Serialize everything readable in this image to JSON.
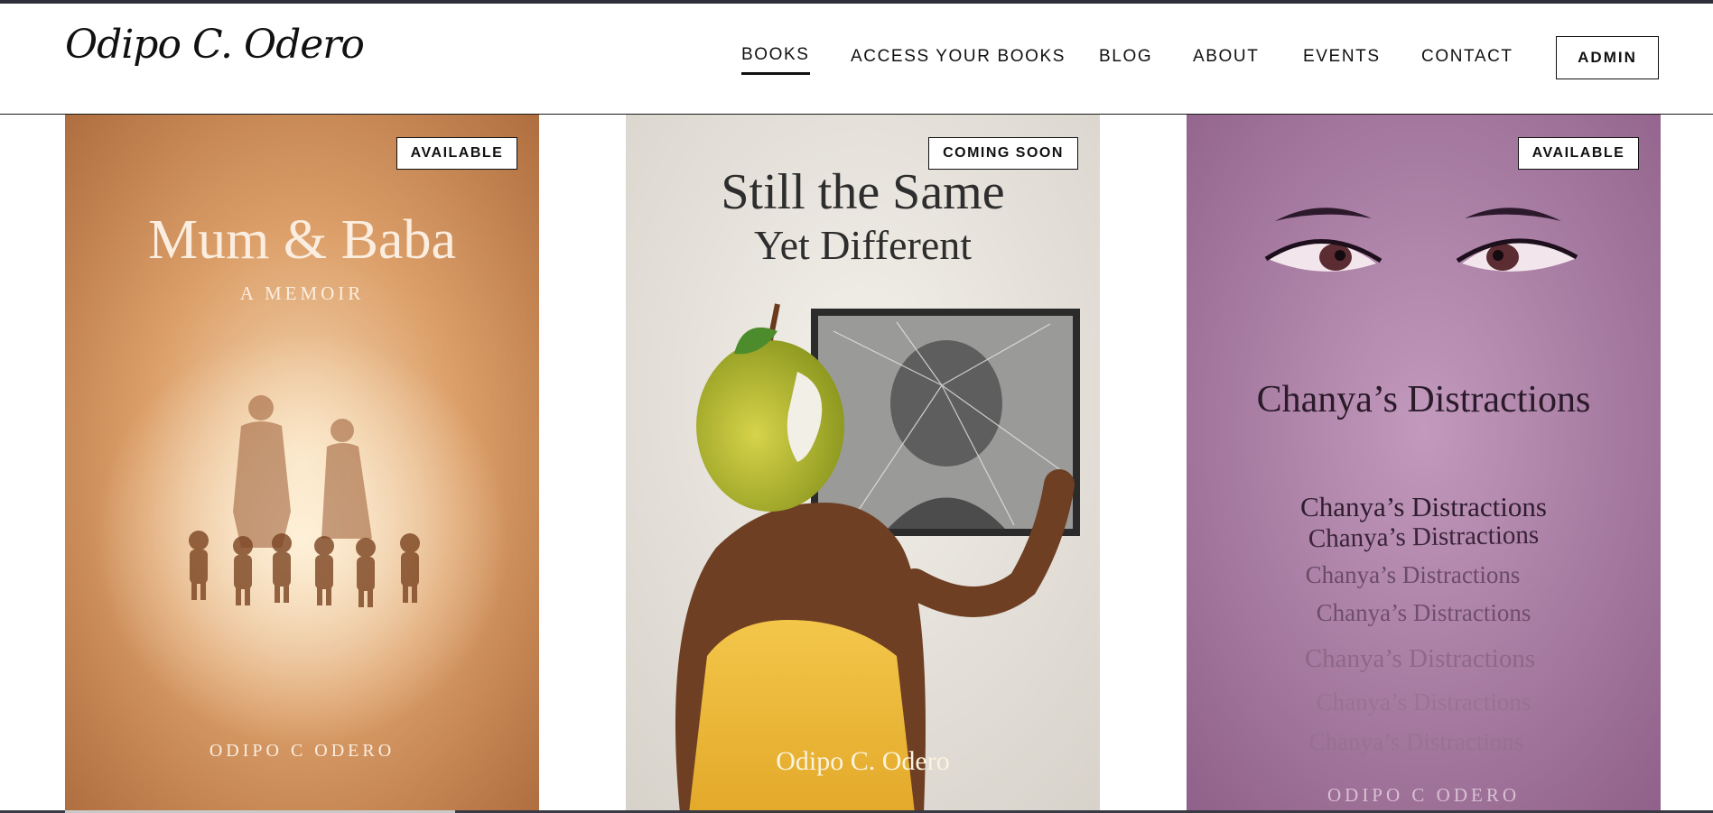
{
  "site": {
    "logo_text": "Odipo C. Odero"
  },
  "nav": {
    "items": [
      {
        "label": "BOOKS",
        "active": true
      },
      {
        "label": "ACCESS YOUR BOOKS",
        "active": false
      },
      {
        "label": "BLOG",
        "active": false
      },
      {
        "label": "ABOUT",
        "active": false
      },
      {
        "label": "EVENTS",
        "active": false
      },
      {
        "label": "CONTACT",
        "active": false
      }
    ],
    "admin_label": "ADMIN"
  },
  "books": [
    {
      "badge": "AVAILABLE",
      "title": "Mum & Baba",
      "subtitle": "A MEMOIR",
      "author": "ODIPO C ODERO",
      "cover_color": "#c98a55"
    },
    {
      "badge": "COMING SOON",
      "title_line1": "Still the Same",
      "title_line2": "Yet Different",
      "author": "Odipo C. Odero",
      "cover_color": "#e6e2dc"
    },
    {
      "badge": "AVAILABLE",
      "title": "Chanya’s Distractions",
      "repeat_text": "Chanya’s Distractions",
      "author": "ODIPO C ODERO",
      "cover_color": "#a77aa0"
    }
  ]
}
